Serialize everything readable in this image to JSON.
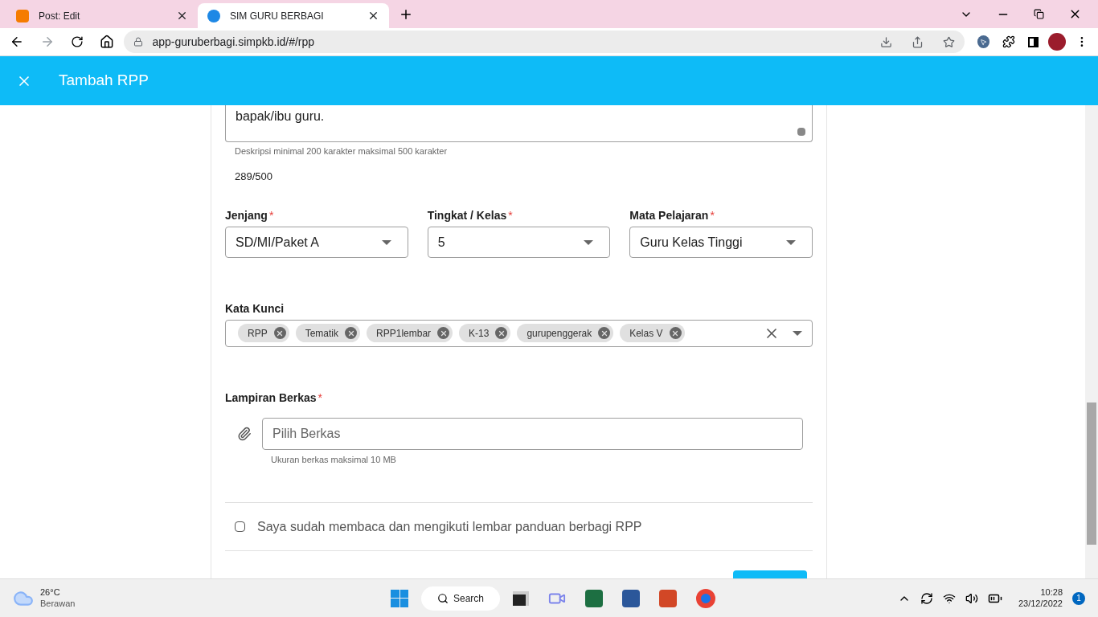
{
  "browser": {
    "tabs": [
      {
        "title": "Post: Edit",
        "kind": "blog",
        "selected": false
      },
      {
        "title": "SIM GURU BERBAGI",
        "kind": "app",
        "selected": true
      }
    ],
    "url": "app-guruberbagi.simpkb.id/#/rpp"
  },
  "header": {
    "title": "Tambah RPP"
  },
  "description": {
    "value": "bapak/ibu guru.",
    "hint": "Deskripsi minimal 200 karakter maksimal 500 karakter",
    "counter": "289/500"
  },
  "selects": [
    {
      "label": "Jenjang",
      "required_mark": "*",
      "value": "SD/MI/Paket A"
    },
    {
      "label": "Tingkat / Kelas",
      "required_mark": "*",
      "value": "5"
    },
    {
      "label": "Mata Pelajaran",
      "required_mark": "*",
      "value": "Guru Kelas Tinggi"
    }
  ],
  "keywords": {
    "label": "Kata Kunci",
    "chips": [
      "RPP",
      "Tematik",
      "RPP1lembar",
      "K-13",
      "gurupenggerak",
      "Kelas V"
    ]
  },
  "attachment": {
    "label": "Lampiran Berkas",
    "required_mark": "*",
    "placeholder": "Pilih Berkas",
    "hint": "Ukuran berkas maksimal 10 MB"
  },
  "agreement": {
    "label": "Saya sudah membaca dan mengikuti lembar panduan berbagi RPP",
    "checked": false
  },
  "taskbar": {
    "temperature": "26°C",
    "condition": "Berawan",
    "search": "Search",
    "time": "10:28",
    "date": "23/12/2022",
    "notifications": "1"
  }
}
